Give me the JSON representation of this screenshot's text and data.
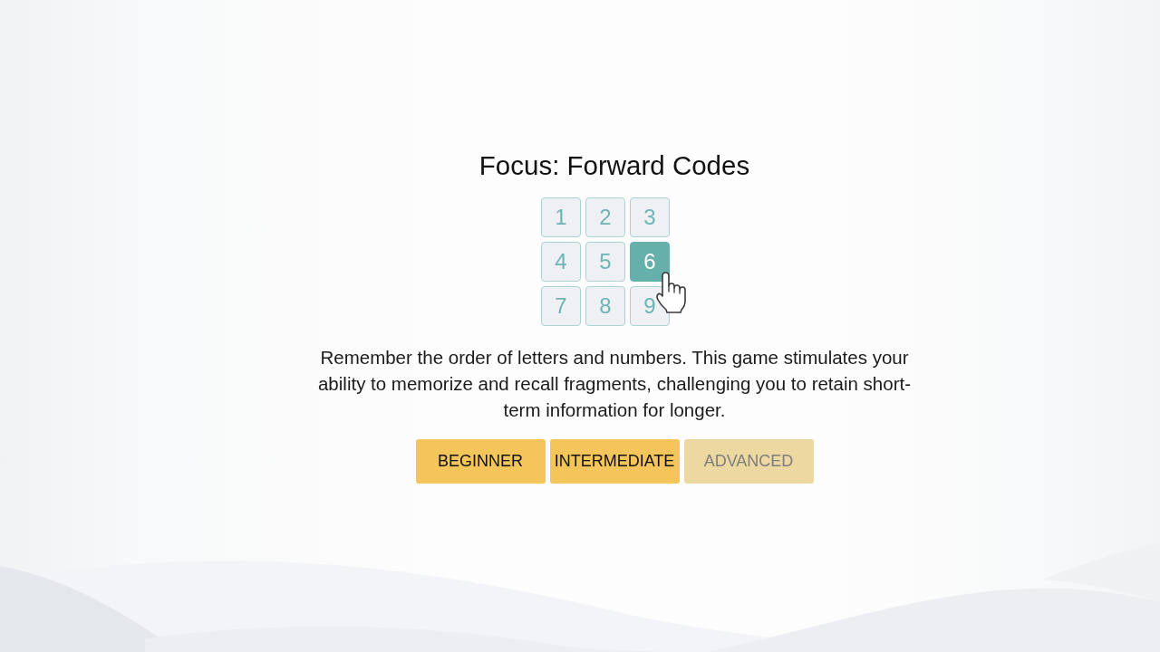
{
  "title": "Focus: Forward Codes",
  "keypad": {
    "keys": [
      {
        "label": "1",
        "selected": false
      },
      {
        "label": "2",
        "selected": false
      },
      {
        "label": "3",
        "selected": false
      },
      {
        "label": "4",
        "selected": false
      },
      {
        "label": "5",
        "selected": false
      },
      {
        "label": "6",
        "selected": true
      },
      {
        "label": "7",
        "selected": false
      },
      {
        "label": "8",
        "selected": false
      },
      {
        "label": "9",
        "selected": false
      }
    ]
  },
  "description": "Remember the order of letters and numbers. This game stimulates your ability to memorize and recall fragments, challenging you to retain short-term information for longer.",
  "levels": [
    {
      "label": "BEGINNER",
      "disabled": false
    },
    {
      "label": "INTERMEDIATE",
      "disabled": false
    },
    {
      "label": "ADVANCED",
      "disabled": true
    }
  ]
}
